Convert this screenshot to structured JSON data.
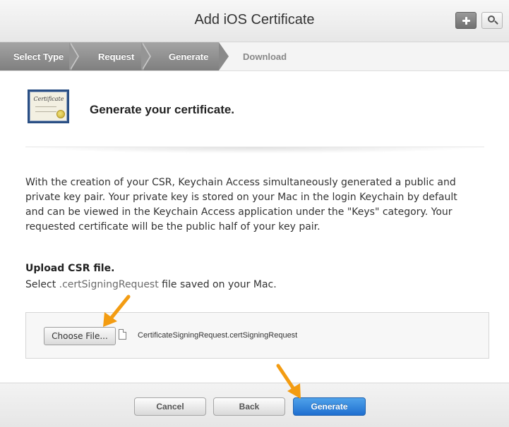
{
  "header": {
    "title": "Add iOS Certificate",
    "add_icon": "plus-icon",
    "search_icon": "magnifier-icon"
  },
  "steps": [
    {
      "label": "Select Type",
      "state": "complete"
    },
    {
      "label": "Request",
      "state": "complete"
    },
    {
      "label": "Generate",
      "state": "current"
    },
    {
      "label": "Download",
      "state": "upcoming"
    }
  ],
  "content": {
    "certificate_icon_text": "Certificate",
    "heading": "Generate your certificate.",
    "description": "With the creation of your CSR, Keychain Access simultaneously generated a public and private key pair. Your private key is stored on your Mac in the login Keychain by default and can be viewed in the Keychain Access application under the \"Keys\" category. Your requested certificate will be the public half of your key pair.",
    "upload_heading": "Upload CSR file.",
    "upload_prefix": "Select",
    "upload_ext": ".certSigningRequest",
    "upload_suffix": "file saved on your Mac."
  },
  "file_picker": {
    "button_label": "Choose File...",
    "file_name": "CertificateSigningRequest.certSigningRequest",
    "file_icon": "document-icon"
  },
  "footer": {
    "cancel_label": "Cancel",
    "back_label": "Back",
    "generate_label": "Generate"
  },
  "colors": {
    "accent_blue": "#2a7fdc",
    "annotation_orange": "#f39c12",
    "step_active": "#8e8e8e"
  }
}
